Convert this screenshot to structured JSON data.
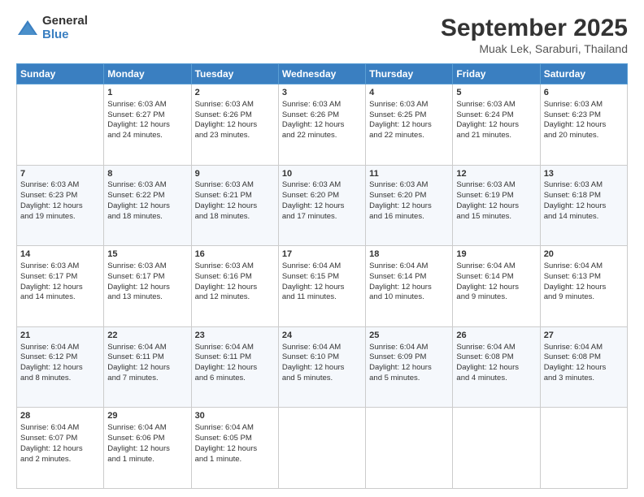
{
  "header": {
    "logo": {
      "general": "General",
      "blue": "Blue"
    },
    "title": "September 2025",
    "subtitle": "Muak Lek, Saraburi, Thailand"
  },
  "columns": [
    "Sunday",
    "Monday",
    "Tuesday",
    "Wednesday",
    "Thursday",
    "Friday",
    "Saturday"
  ],
  "weeks": [
    [
      {
        "day": "",
        "content": ""
      },
      {
        "day": "1",
        "content": "Sunrise: 6:03 AM\nSunset: 6:27 PM\nDaylight: 12 hours\nand 24 minutes."
      },
      {
        "day": "2",
        "content": "Sunrise: 6:03 AM\nSunset: 6:26 PM\nDaylight: 12 hours\nand 23 minutes."
      },
      {
        "day": "3",
        "content": "Sunrise: 6:03 AM\nSunset: 6:26 PM\nDaylight: 12 hours\nand 22 minutes."
      },
      {
        "day": "4",
        "content": "Sunrise: 6:03 AM\nSunset: 6:25 PM\nDaylight: 12 hours\nand 22 minutes."
      },
      {
        "day": "5",
        "content": "Sunrise: 6:03 AM\nSunset: 6:24 PM\nDaylight: 12 hours\nand 21 minutes."
      },
      {
        "day": "6",
        "content": "Sunrise: 6:03 AM\nSunset: 6:23 PM\nDaylight: 12 hours\nand 20 minutes."
      }
    ],
    [
      {
        "day": "7",
        "content": "Sunrise: 6:03 AM\nSunset: 6:23 PM\nDaylight: 12 hours\nand 19 minutes."
      },
      {
        "day": "8",
        "content": "Sunrise: 6:03 AM\nSunset: 6:22 PM\nDaylight: 12 hours\nand 18 minutes."
      },
      {
        "day": "9",
        "content": "Sunrise: 6:03 AM\nSunset: 6:21 PM\nDaylight: 12 hours\nand 18 minutes."
      },
      {
        "day": "10",
        "content": "Sunrise: 6:03 AM\nSunset: 6:20 PM\nDaylight: 12 hours\nand 17 minutes."
      },
      {
        "day": "11",
        "content": "Sunrise: 6:03 AM\nSunset: 6:20 PM\nDaylight: 12 hours\nand 16 minutes."
      },
      {
        "day": "12",
        "content": "Sunrise: 6:03 AM\nSunset: 6:19 PM\nDaylight: 12 hours\nand 15 minutes."
      },
      {
        "day": "13",
        "content": "Sunrise: 6:03 AM\nSunset: 6:18 PM\nDaylight: 12 hours\nand 14 minutes."
      }
    ],
    [
      {
        "day": "14",
        "content": "Sunrise: 6:03 AM\nSunset: 6:17 PM\nDaylight: 12 hours\nand 14 minutes."
      },
      {
        "day": "15",
        "content": "Sunrise: 6:03 AM\nSunset: 6:17 PM\nDaylight: 12 hours\nand 13 minutes."
      },
      {
        "day": "16",
        "content": "Sunrise: 6:03 AM\nSunset: 6:16 PM\nDaylight: 12 hours\nand 12 minutes."
      },
      {
        "day": "17",
        "content": "Sunrise: 6:04 AM\nSunset: 6:15 PM\nDaylight: 12 hours\nand 11 minutes."
      },
      {
        "day": "18",
        "content": "Sunrise: 6:04 AM\nSunset: 6:14 PM\nDaylight: 12 hours\nand 10 minutes."
      },
      {
        "day": "19",
        "content": "Sunrise: 6:04 AM\nSunset: 6:14 PM\nDaylight: 12 hours\nand 9 minutes."
      },
      {
        "day": "20",
        "content": "Sunrise: 6:04 AM\nSunset: 6:13 PM\nDaylight: 12 hours\nand 9 minutes."
      }
    ],
    [
      {
        "day": "21",
        "content": "Sunrise: 6:04 AM\nSunset: 6:12 PM\nDaylight: 12 hours\nand 8 minutes."
      },
      {
        "day": "22",
        "content": "Sunrise: 6:04 AM\nSunset: 6:11 PM\nDaylight: 12 hours\nand 7 minutes."
      },
      {
        "day": "23",
        "content": "Sunrise: 6:04 AM\nSunset: 6:11 PM\nDaylight: 12 hours\nand 6 minutes."
      },
      {
        "day": "24",
        "content": "Sunrise: 6:04 AM\nSunset: 6:10 PM\nDaylight: 12 hours\nand 5 minutes."
      },
      {
        "day": "25",
        "content": "Sunrise: 6:04 AM\nSunset: 6:09 PM\nDaylight: 12 hours\nand 5 minutes."
      },
      {
        "day": "26",
        "content": "Sunrise: 6:04 AM\nSunset: 6:08 PM\nDaylight: 12 hours\nand 4 minutes."
      },
      {
        "day": "27",
        "content": "Sunrise: 6:04 AM\nSunset: 6:08 PM\nDaylight: 12 hours\nand 3 minutes."
      }
    ],
    [
      {
        "day": "28",
        "content": "Sunrise: 6:04 AM\nSunset: 6:07 PM\nDaylight: 12 hours\nand 2 minutes."
      },
      {
        "day": "29",
        "content": "Sunrise: 6:04 AM\nSunset: 6:06 PM\nDaylight: 12 hours\nand 1 minute."
      },
      {
        "day": "30",
        "content": "Sunrise: 6:04 AM\nSunset: 6:05 PM\nDaylight: 12 hours\nand 1 minute."
      },
      {
        "day": "",
        "content": ""
      },
      {
        "day": "",
        "content": ""
      },
      {
        "day": "",
        "content": ""
      },
      {
        "day": "",
        "content": ""
      }
    ]
  ]
}
